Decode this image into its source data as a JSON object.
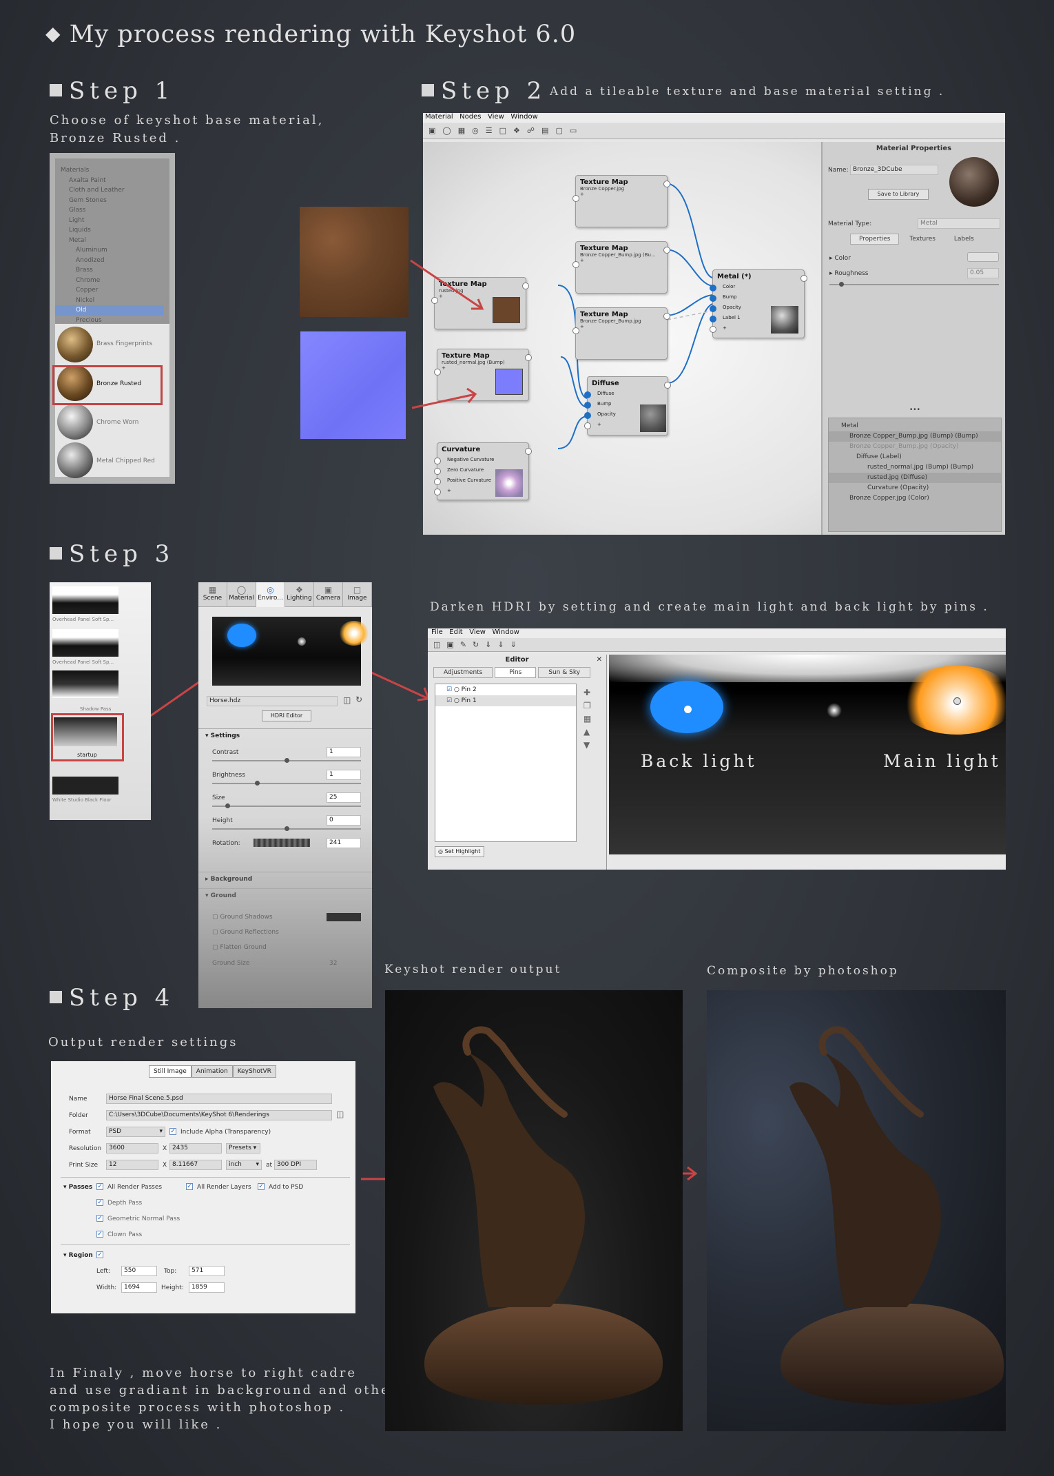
{
  "title": "My process rendering with Keyshot 6.0",
  "step1": {
    "heading": "Step 1",
    "desc_lines": [
      "Choose of keyshot base material,",
      "Bronze Rusted ."
    ],
    "tree": [
      "Materials",
      "Axalta Paint",
      "Cloth and Leather",
      "Gem Stones",
      "Glass",
      "Light",
      "Liquids",
      "Metal",
      "Aluminum",
      "Anodized",
      "Brass",
      "Chrome",
      "Copper",
      "Nickel",
      "Old",
      "Precious"
    ],
    "thumbs": [
      "Brass Fingerprints",
      "Bronze Rusted",
      "Chrome Worn",
      "Metal Chipped Red"
    ]
  },
  "step2": {
    "heading": "Step 2",
    "subtitle": "Add a tileable texture and base material setting .",
    "menu": [
      "Material",
      "Nodes",
      "View",
      "Window"
    ],
    "nodes": {
      "tm1": {
        "title": "Texture Map",
        "sub": "Bronze Copper.jpg"
      },
      "tm2": {
        "title": "Texture Map",
        "sub": "Bronze Copper_Bump.jpg (Bu..."
      },
      "tm3": {
        "title": "Texture Map",
        "sub": "Bronze Copper_Bump.jpg"
      },
      "tm4": {
        "title": "Texture Map",
        "sub": "rusted.jpg"
      },
      "tm5": {
        "title": "Texture Map",
        "sub": "rusted_normal.jpg (Bump)"
      },
      "metal": {
        "title": "Metal (*)",
        "ports": [
          "Color",
          "Bump",
          "Opacity",
          "Label 1"
        ]
      },
      "diffuse": {
        "title": "Diffuse",
        "ports": [
          "Diffuse",
          "Bump",
          "Opacity"
        ]
      },
      "curv": {
        "title": "Curvature",
        "ports": [
          "Negative Curvature",
          "Zero Curvature",
          "Positive Curvature"
        ]
      }
    },
    "plus": "+",
    "props": {
      "header": "Material Properties",
      "name_label": "Name:",
      "name_value": "Bronze_3DCube",
      "save_btn": "Save to Library",
      "type_label": "Material Type:",
      "type_value": "Metal",
      "tabs": [
        "Properties",
        "Textures",
        "Labels"
      ],
      "color_label": "Color",
      "rough_label": "Roughness",
      "rough_value": "0.05",
      "dots": "•••",
      "tree": [
        "Metal",
        "Bronze Copper_Bump.jpg (Bump) (Bump)",
        "Bronze Copper_Bump.jpg (Opacity)",
        "Diffuse (Label)",
        "rusted_normal.jpg (Bump) (Bump)",
        "rusted.jpg (Diffuse)",
        "Curvature (Opacity)",
        "Bronze Copper.jpg (Color)"
      ]
    }
  },
  "step3": {
    "heading": "Step 3",
    "env_list": [
      "Overhead Panel Soft Sp...",
      "Overhead Panel Soft Sp...",
      "Shadow Pass",
      "startup",
      "White Studio Black Floor"
    ],
    "tabs": [
      "Scene",
      "Material",
      "Enviro...",
      "Lighting",
      "Camera",
      "Image"
    ],
    "hdri_file": "Horse.hdz",
    "hdri_btn": "HDRI Editor",
    "settings": "Settings",
    "params": [
      {
        "label": "Contrast",
        "value": "1"
      },
      {
        "label": "Brightness",
        "value": "1"
      },
      {
        "label": "Size",
        "value": "25"
      },
      {
        "label": "Height",
        "value": "0"
      },
      {
        "label": "Rotation:",
        "value": "241"
      }
    ],
    "background": "Background",
    "ground": "Ground",
    "ground_opts": [
      "Ground Shadows",
      "Ground Reflections",
      "Flatten Ground",
      "Ground Size"
    ],
    "ground_size": "32",
    "desc": "Darken HDRI by setting and create main light and back light by pins .",
    "editor_menu": [
      "File",
      "Edit",
      "View",
      "Window"
    ],
    "editor_title": "Editor",
    "editor_tabs": [
      "Adjustments",
      "Pins",
      "Sun & Sky"
    ],
    "pins": [
      "Pin 2",
      "Pin 1"
    ],
    "set_highlight": "Set Highlight",
    "back_light": "Back light",
    "main_light": "Main light"
  },
  "step4": {
    "heading": "Step 4",
    "subtitle": "Output render settings",
    "tabs": [
      "Still Image",
      "Animation",
      "KeyShotVR"
    ],
    "name_label": "Name",
    "name_value": "Horse Final Scene.5.psd",
    "folder_label": "Folder",
    "folder_value": "C:\\Users\\3DCube\\Documents\\KeyShot 6\\Renderings",
    "format_label": "Format",
    "format_value": "PSD",
    "alpha_label": "Include Alpha (Transparency)",
    "res_label": "Resolution",
    "res_w": "3600",
    "res_x": "X",
    "res_h": "2435",
    "presets": "Presets",
    "print_label": "Print Size",
    "print_w": "12",
    "print_h": "8.11667",
    "unit": "inch",
    "at": "at",
    "dpi": "300 DPI",
    "passes_label": "Passes",
    "passes": [
      "All Render Passes",
      "All Render Layers",
      "Add to PSD",
      "Depth Pass",
      "Geometric Normal Pass",
      "Clown Pass"
    ],
    "region_label": "Region",
    "left_label": "Left:",
    "left_value": "550",
    "top_label": "Top:",
    "top_value": "571",
    "width_label": "Width:",
    "width_value": "1694",
    "height_label": "Height:",
    "height_value": "1859",
    "outro": [
      "In Finaly , move horse to right cadre",
      "and use gradiant in background and other",
      "composite process with photoshop .",
      "I hope you will like ."
    ]
  },
  "render_label": "Keyshot render output",
  "composite_label": "Composite by photoshop",
  "colors": {
    "accent_red": "#c94444",
    "node_blue": "#1f6fc5",
    "bronze": "#6b4529",
    "normal_map": "#7b7dfd",
    "bg": "#33373d"
  }
}
